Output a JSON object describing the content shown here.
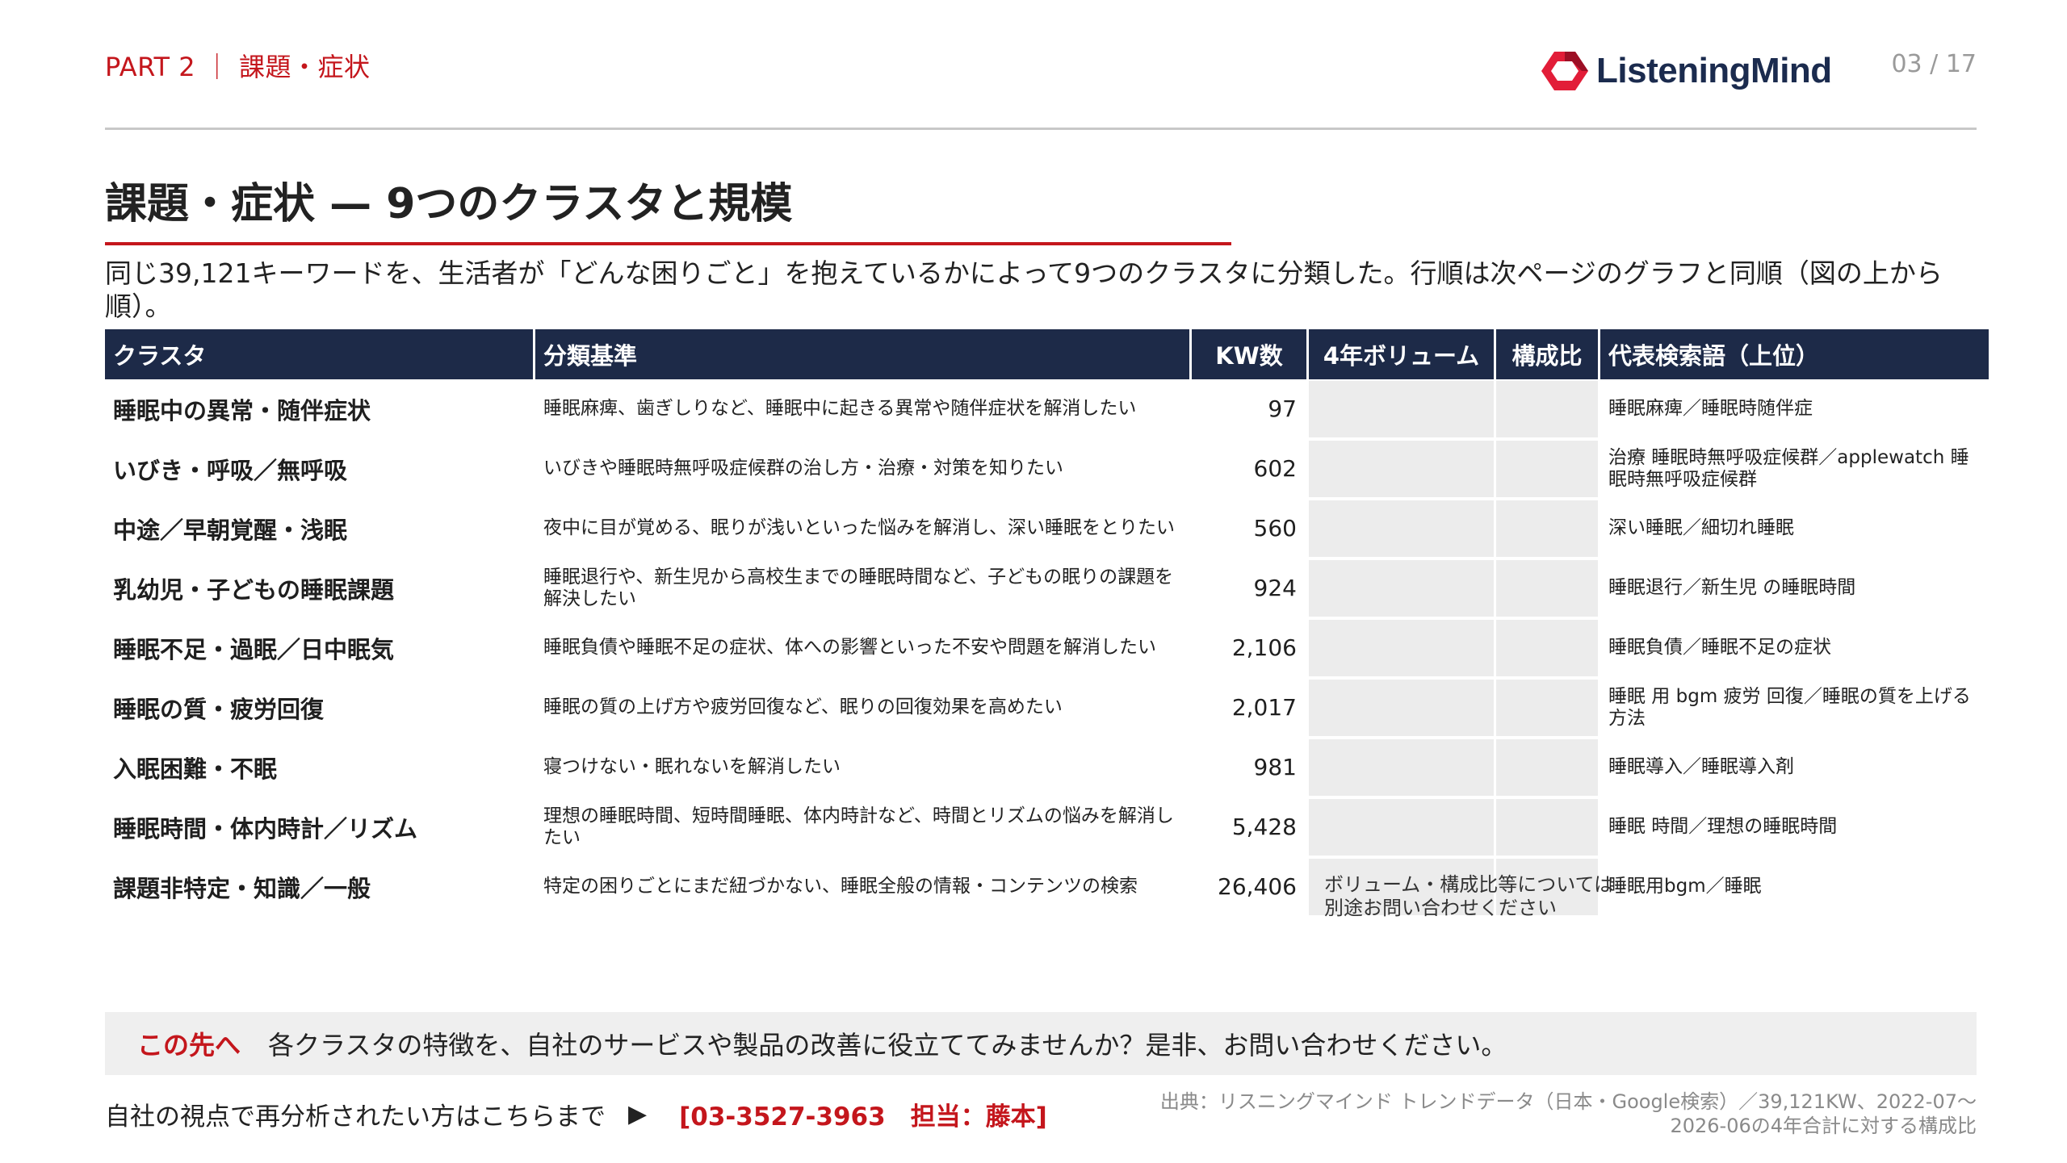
{
  "header": {
    "part": "PART 2 ｜ 課題・症状",
    "logo_text": "ListeningMind",
    "page": "03 / 17"
  },
  "title": "課題・症状 — 9つのクラスタと規模",
  "description": "同じ39,121キーワードを、生活者が「どんな困りごと」を抱えているかによって9つのクラスタに分類した。行順は次ページのグラフと同順（図の上から順）。",
  "table": {
    "headers": [
      "クラスタ",
      "分類基準",
      "KW数",
      "4年ボリューム",
      "構成比",
      "代表検索語（上位）"
    ],
    "rows": [
      {
        "cluster": "睡眠中の異常・随伴症状",
        "criteria": "睡眠麻痺、歯ぎしりなど、睡眠中に起きる異常や随伴症状を解消したい",
        "kw": "97",
        "terms": "睡眠麻痺／睡眠時随伴症"
      },
      {
        "cluster": "いびき・呼吸／無呼吸",
        "criteria": "いびきや睡眠時無呼吸症候群の治し方・治療・対策を知りたい",
        "kw": "602",
        "terms": "治療 睡眠時無呼吸症候群／applewatch 睡眠時無呼吸症候群"
      },
      {
        "cluster": "中途／早朝覚醒・浅眠",
        "criteria": "夜中に目が覚める、眠りが浅いといった悩みを解消し、深い睡眠をとりたい",
        "kw": "560",
        "terms": "深い睡眠／細切れ睡眠"
      },
      {
        "cluster": "乳幼児・子どもの睡眠課題",
        "criteria": "睡眠退行や、新生児から高校生までの睡眠時間など、子どもの眠りの課題を解決したい",
        "kw": "924",
        "terms": "睡眠退行／新生児 の睡眠時間"
      },
      {
        "cluster": "睡眠不足・過眠／日中眠気",
        "criteria": "睡眠負債や睡眠不足の症状、体への影響といった不安や問題を解消したい",
        "kw": "2,106",
        "terms": "睡眠負債／睡眠不足の症状"
      },
      {
        "cluster": "睡眠の質・疲労回復",
        "criteria": "睡眠の質の上げ方や疲労回復など、眠りの回復効果を高めたい",
        "kw": "2,017",
        "terms": "睡眠 用 bgm 疲労 回復／睡眠の質を上げる方法"
      },
      {
        "cluster": "入眠困難・不眠",
        "criteria": "寝つけない・眠れないを解消したい",
        "kw": "981",
        "terms": "睡眠導入／睡眠導入剤"
      },
      {
        "cluster": "睡眠時間・体内時計／リズム",
        "criteria": "理想の睡眠時間、短時間睡眠、体内時計など、時間とリズムの悩みを解消したい",
        "kw": "5,428",
        "terms": "睡眠 時間／理想の睡眠時間"
      },
      {
        "cluster": "課題非特定・知識／一般",
        "criteria": "特定の困りごとにまだ紐づかない、睡眠全般の情報・コンテンツの検索",
        "kw": "26,406",
        "terms": "睡眠用bgm／睡眠"
      }
    ]
  },
  "volume_note": [
    "ボリューム・構成比等については",
    "別途お問い合わせください"
  ],
  "cta": {
    "label": "この先へ",
    "text": "各クラスタの特徴を、自社のサービスや製品の改善に役立ててみませんか？是非、お問い合わせください。"
  },
  "contact": {
    "text": "自社の視点で再分析されたい方はこちらまで",
    "arrow": "▶",
    "info": "[03-3527-3963　担当：藤本]"
  },
  "source": [
    "出典：リスニングマインド トレンドデータ（日本・Google検索）／39,121KW、2022-07〜",
    "2026-06の4年合計に対する構成比"
  ],
  "colors": {
    "accent": "#c4161c",
    "header_bg": "#1d2a48",
    "placeholder": "#ececec"
  }
}
